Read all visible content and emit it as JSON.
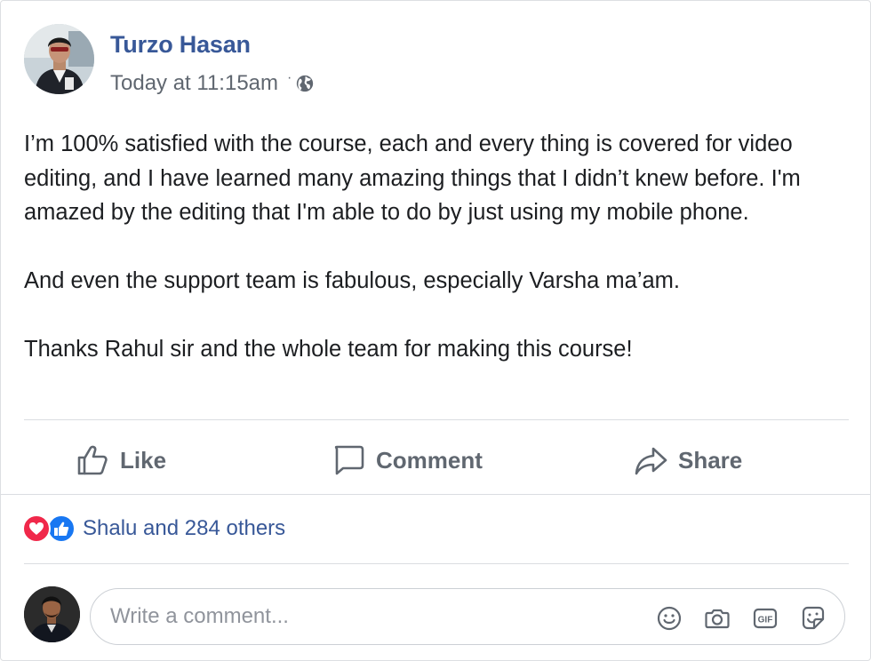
{
  "post": {
    "author": "Turzo Hasan",
    "timestamp": "Today at 11:15am",
    "separator": "·",
    "privacy_icon": "globe-icon",
    "paragraphs": [
      "I’m 100% satisfied with the course, each and every thing is covered for video editing, and I have learned many amazing things that I didn’t knew before. I'm amazed by the editing that I'm able to do by just using my mobile phone.",
      "And even the support team is fabulous, especially Varsha ma’am.",
      "Thanks Rahul sir and the whole team for making this course!"
    ]
  },
  "actions": {
    "like_label": "Like",
    "comment_label": "Comment",
    "share_label": "Share"
  },
  "reactions": {
    "icons": [
      "love-icon",
      "like-icon"
    ],
    "summary": "Shalu and 284 others"
  },
  "comment_box": {
    "placeholder": "Write a comment...",
    "icons": [
      "emoji-icon",
      "camera-icon",
      "gif-icon",
      "sticker-icon"
    ]
  },
  "colors": {
    "author_link": "#385898",
    "secondary_text": "#606770",
    "love_reaction": "#f0284a",
    "like_reaction": "#1877f2",
    "divider": "#dadde1"
  }
}
